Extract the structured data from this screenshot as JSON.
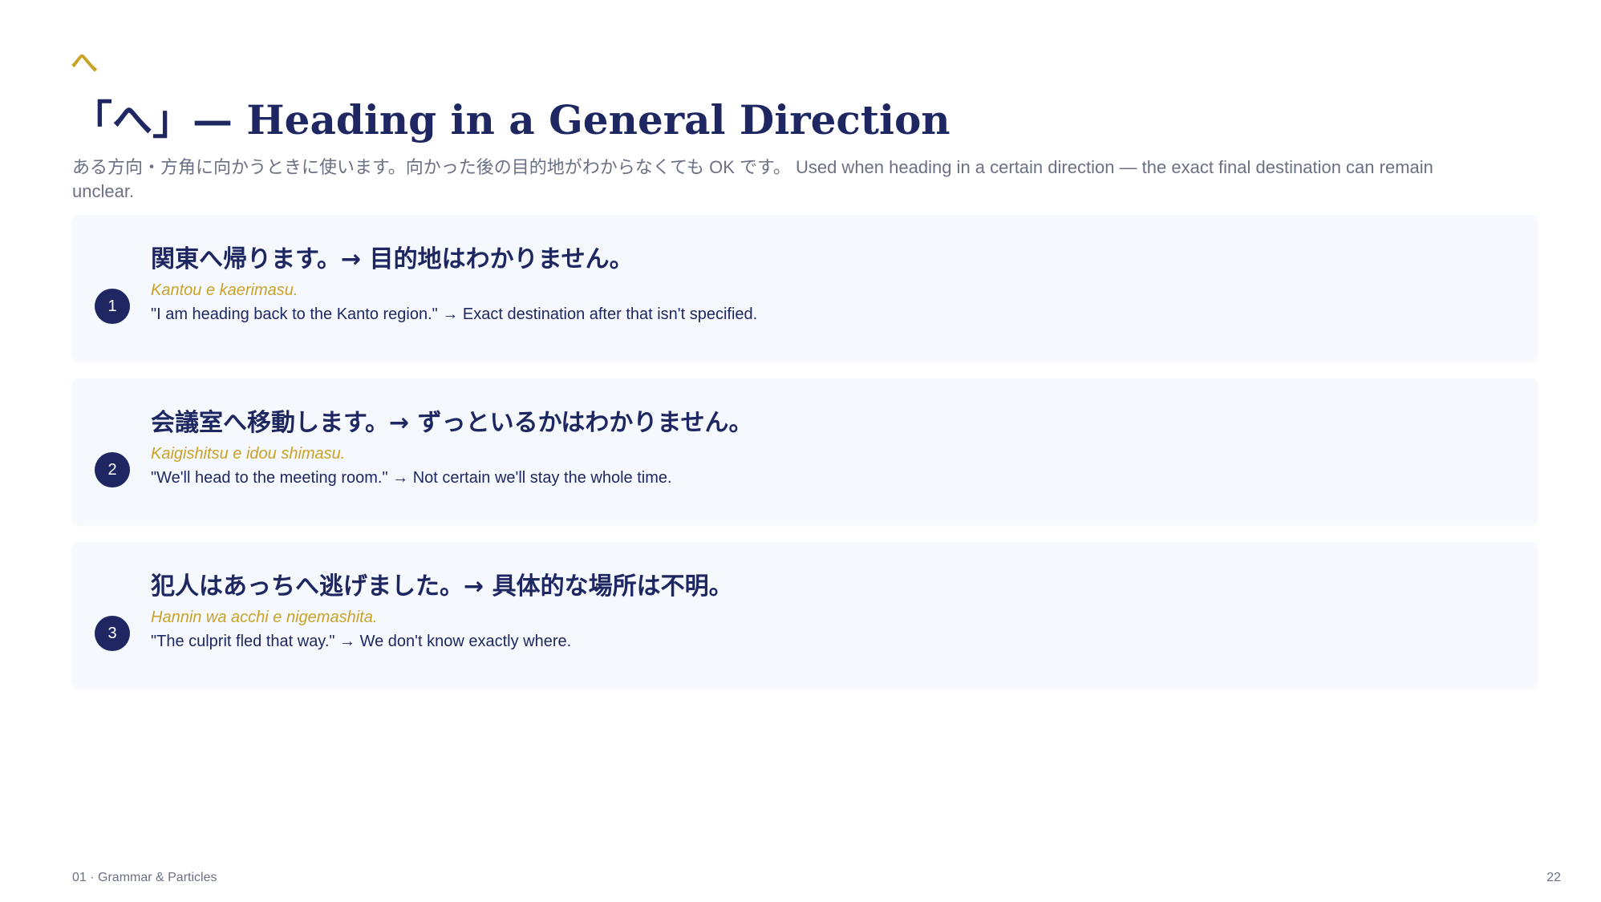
{
  "header": {
    "mark": "へ",
    "title": "「へ」— Heading in a General Direction",
    "subtitle": "ある方向・方角に向かうときに使います。向かった後の目的地がわからなくても OK です。 Used when heading in a certain direction — the exact final destination can remain unclear."
  },
  "examples": [
    {
      "number": "1",
      "japanese": "関東へ帰ります。→ 目的地はわかりません。",
      "romaji": "Kantou e kaerimasu.",
      "english": "\"I am heading back to the Kanto region.\" → Exact destination after that isn't specified."
    },
    {
      "number": "2",
      "japanese": "会議室へ移動します。→ ずっといるかはわかりません。",
      "romaji": "Kaigishitsu e idou shimasu.",
      "english": "\"We'll head to the meeting room.\" → Not certain we'll stay the whole time."
    },
    {
      "number": "3",
      "japanese": "犯人はあっちへ逃げました。→ 具体的な場所は不明。",
      "romaji": "Hannin wa acchi e nigemashita.",
      "english": "\"The culprit fled that way.\" → We don't know exactly where."
    }
  ],
  "footer": {
    "section": "01 · Grammar & Particles",
    "page_number": "22"
  },
  "colors": {
    "navy": "#1e2761",
    "gold": "#c9a227",
    "card_bg": "#f5f8fd",
    "muted": "#6b7184"
  }
}
